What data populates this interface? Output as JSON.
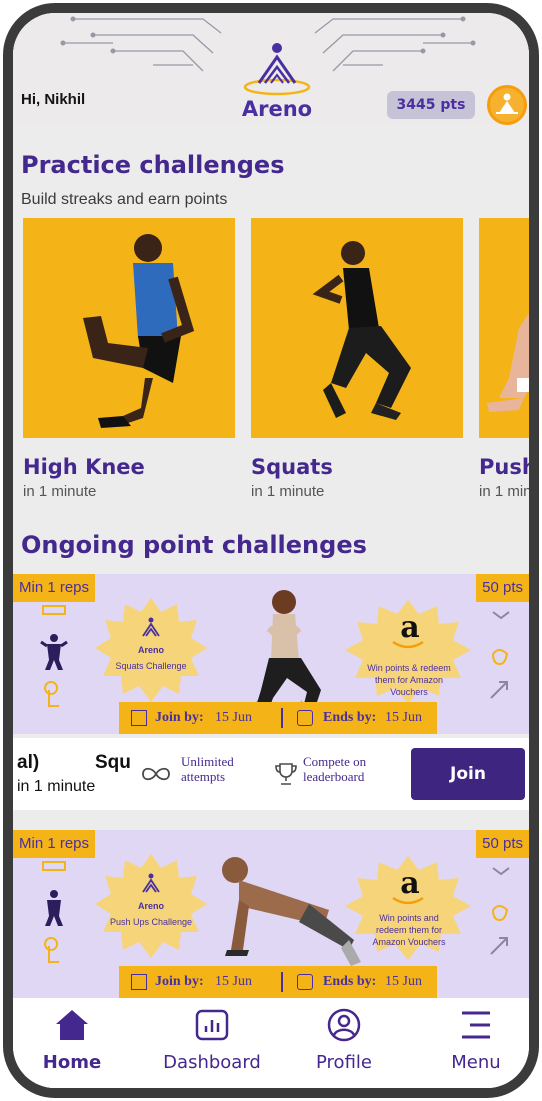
{
  "header": {
    "greeting": "Hi, Nikhil",
    "logo_text": "Areno",
    "points": "3445 pts",
    "avatar_icon": "meditation-icon"
  },
  "practice": {
    "title": "Practice challenges",
    "subtitle": "Build streaks and earn points",
    "cards": [
      {
        "title": "High Knee",
        "sub": "in 1 minute"
      },
      {
        "title": "Squats",
        "sub": "in 1 minute"
      },
      {
        "title": "Push-",
        "sub": "in 1 min"
      }
    ]
  },
  "ongoing": {
    "title": "Ongoing point challenges",
    "challenges": [
      {
        "min_reps": "Min 1 reps",
        "points": "50 pts",
        "logo_text": "Areno",
        "challenge_name": "Squats Challenge",
        "reward_text": "Win points & redeem them for Amazon Vouchers",
        "amazon_letter": "a",
        "join_by_label": "Join by:",
        "join_by_date": "15 Jun",
        "ends_by_label": "Ends by:",
        "ends_by_date": "15 Jun"
      },
      {
        "min_reps": "Min 1 reps",
        "points": "50 pts",
        "logo_text": "Areno",
        "challenge_name": "Push Ups Challenge",
        "reward_text": "Win points and redeem them for Amazon Vouchers",
        "amazon_letter": "a",
        "join_by_label": "Join by:",
        "join_by_date": "15 Jun",
        "ends_by_label": "Ends by:",
        "ends_by_date": "15 Jun"
      }
    ],
    "info": {
      "partial_left": "al)",
      "partial_name": "Squ",
      "duration": "in 1 minute",
      "unlimited": "Unlimited attempts",
      "compete": "Compete on leaderboard",
      "join": "Join"
    }
  },
  "nav": {
    "items": [
      {
        "label": "Home",
        "icon": "home-icon"
      },
      {
        "label": "Dashboard",
        "icon": "dashboard-icon"
      },
      {
        "label": "Profile",
        "icon": "profile-icon"
      },
      {
        "label": "Menu",
        "icon": "menu-icon"
      }
    ]
  },
  "colors": {
    "brand_purple": "#45288e",
    "brand_yellow": "#f4b418",
    "lavender": "#e0d7f5"
  }
}
